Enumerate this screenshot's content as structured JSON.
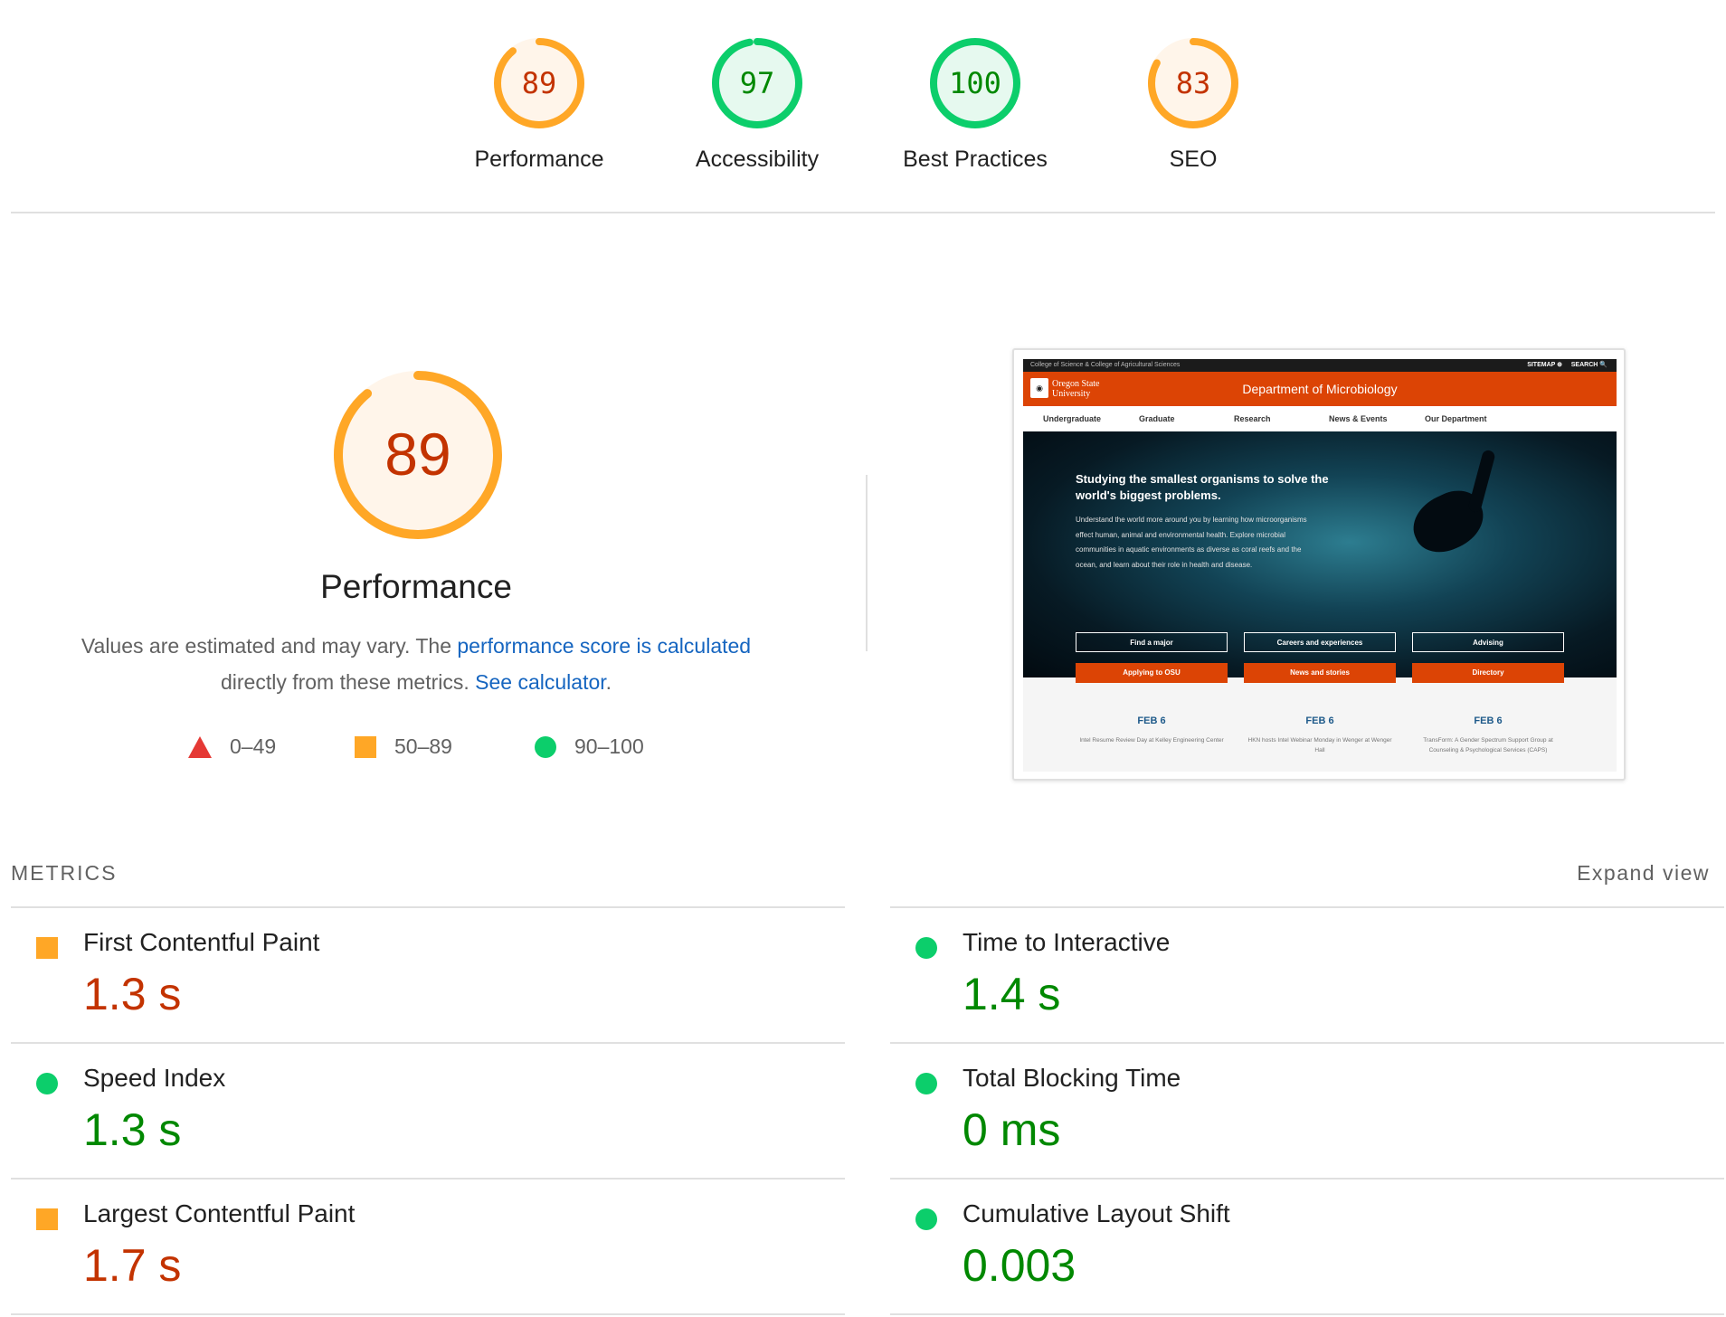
{
  "categories": [
    {
      "label": "Performance",
      "score": "89",
      "rating": "average"
    },
    {
      "label": "Accessibility",
      "score": "97",
      "rating": "pass"
    },
    {
      "label": "Best Practices",
      "score": "100",
      "rating": "pass"
    },
    {
      "label": "SEO",
      "score": "83",
      "rating": "average"
    }
  ],
  "colors": {
    "pass": "#0cce6b",
    "pass_text": "#008800",
    "pass_bg": "#e6f9ef",
    "average": "#ffa726",
    "average_text": "#c33300",
    "average_bg": "#fff5ea",
    "fail": "#e53935",
    "link": "#1565c0"
  },
  "summary": {
    "score": "89",
    "title": "Performance",
    "desc_prefix": "Values are estimated and may vary. The ",
    "desc_link": "performance score is calculated",
    "desc_middle": " directly from these metrics. ",
    "desc_link2": "See calculator",
    "desc_suffix": "."
  },
  "legend": [
    {
      "icon": "fail-triangle",
      "label": "0–49"
    },
    {
      "icon": "average-square",
      "label": "50–89"
    },
    {
      "icon": "pass-circle",
      "label": "90–100"
    }
  ],
  "screenshot": {
    "topbar_left": "College of Science & College of Agricultural Sciences",
    "sitemap": "SITEMAP ⊕",
    "search": "SEARCH 🔍",
    "logo_text_1": "Oregon State",
    "logo_text_2": "University",
    "department": "Department of Microbiology",
    "nav": [
      "Undergraduate",
      "Graduate",
      "Research",
      "News & Events",
      "Our Department"
    ],
    "hero_title": "Studying the smallest organisms to solve the world's biggest problems.",
    "hero_body": "Understand the world more around you by learning how microorganisms effect human, animal and environmental health. Explore microbial communities in aquatic environments as diverse as coral reefs and the ocean, and learn about their role in health and disease.",
    "buttons_outline": [
      "Find a major",
      "Careers and experiences",
      "Advising"
    ],
    "buttons_filled": [
      "Applying to OSU",
      "News and stories",
      "Directory"
    ],
    "events": [
      {
        "date": "FEB 6",
        "text": "Intel Resume Review Day at Kelley Engineering Center"
      },
      {
        "date": "FEB 6",
        "text": "HKN hosts Intel Webinar Monday in Wenger at Wenger Hall"
      },
      {
        "date": "FEB 6",
        "text": "TransForm: A Gender Spectrum Support Group at Counseling & Psychological Services (CAPS)"
      }
    ]
  },
  "metrics": {
    "title": "METRICS",
    "expand_label": "Expand view",
    "left": [
      {
        "name": "First Contentful Paint",
        "value": "1.3 s",
        "rating": "average"
      },
      {
        "name": "Speed Index",
        "value": "1.3 s",
        "rating": "pass"
      },
      {
        "name": "Largest Contentful Paint",
        "value": "1.7 s",
        "rating": "average"
      }
    ],
    "right": [
      {
        "name": "Time to Interactive",
        "value": "1.4 s",
        "rating": "pass"
      },
      {
        "name": "Total Blocking Time",
        "value": "0 ms",
        "rating": "pass"
      },
      {
        "name": "Cumulative Layout Shift",
        "value": "0.003",
        "rating": "pass"
      }
    ]
  }
}
